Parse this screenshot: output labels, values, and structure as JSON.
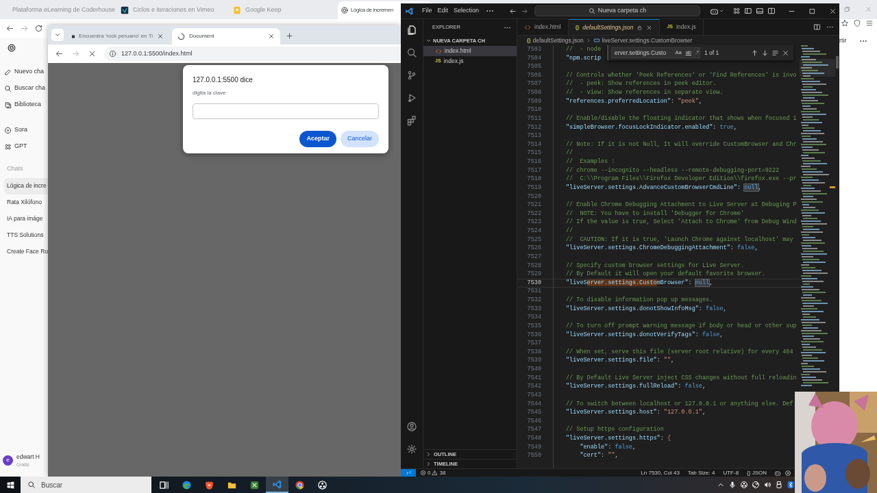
{
  "back_browser": {
    "tabs": [
      {
        "title": "Plataforma eLearning de Coderhouse",
        "kind": "coder",
        "selected": false
      },
      {
        "title": "Ciclos e iteraciones en Vimeo",
        "kind": "vimeo",
        "selected": false
      },
      {
        "title": "Google Keep",
        "kind": "keep",
        "selected": false
      },
      {
        "title": "Lógica de incremen",
        "kind": "openai",
        "selected": true
      }
    ],
    "sidebar": {
      "nav": [
        {
          "label": "Nuevo cha",
          "kind": "edit"
        },
        {
          "label": "Buscar cha",
          "kind": "search"
        },
        {
          "label": "Biblioteca",
          "kind": "library"
        },
        {
          "label": "Sora",
          "kind": "play"
        },
        {
          "label": "GPT",
          "kind": "grid"
        }
      ],
      "section": "Chats",
      "chats": [
        {
          "label": "Lógica de incre",
          "selected": true
        },
        {
          "label": "Rata Xilófono",
          "selected": false
        },
        {
          "label": "IA para imáge",
          "selected": false
        },
        {
          "label": "TTS Solutions",
          "selected": false
        },
        {
          "label": "Create Face Ru",
          "selected": false
        }
      ],
      "user": {
        "initial": "e",
        "name": "edwart H",
        "plan": "Gratis"
      }
    },
    "page_text": "rtir"
  },
  "front_browser": {
    "tabs": [
      {
        "title": "Encuentra 'rock peruano' en Ti",
        "kind": "tiktok",
        "selected": false
      },
      {
        "title": "Document",
        "kind": "loading",
        "selected": true
      }
    ],
    "address": "127.0.0.1:5500/index.html",
    "loading": true,
    "dialog": {
      "title": "127.0.0.1:5500 dice",
      "message": "digita la clave",
      "buttons": [
        {
          "label": "Aceptar",
          "kind": "primary"
        },
        {
          "label": "Cancelar",
          "kind": "secondary"
        }
      ]
    }
  },
  "vscode": {
    "menu": [
      "File",
      "Edit",
      "Selection"
    ],
    "search": "Nueva carpeta ch",
    "explorer": {
      "title": "EXPLORER",
      "folder": {
        "name": "NUEVA CARPETA CH",
        "expanded": true,
        "children": [
          {
            "name": "index.html",
            "kind": "html",
            "selected": true
          },
          {
            "name": "index.js",
            "kind": "js",
            "badge": "JS",
            "selected": false
          }
        ]
      },
      "sections": [
        {
          "label": "OUTLINE",
          "expanded": false
        },
        {
          "label": "TIMELINE",
          "expanded": false
        }
      ]
    },
    "tabs": [
      {
        "label": "index.html",
        "kind": "html",
        "selected": false,
        "preview": false,
        "readonly": false
      },
      {
        "label": "defaultSettings.json",
        "kind": "json",
        "badge": "{}",
        "selected": true,
        "preview": true,
        "readonly": true
      },
      {
        "label": "index.js",
        "kind": "js",
        "badge": "JS",
        "selected": false,
        "preview": false,
        "readonly": false
      }
    ],
    "breadcrumb": [
      {
        "label": "defaultSettings.json",
        "kind": "json",
        "badge": "{}"
      },
      {
        "label": "liveServer.settings.CustomBrowser",
        "kind": "property"
      }
    ],
    "find": {
      "query": "erver.settings.Custo",
      "options": [
        {
          "label": "Aa",
          "on": false
        },
        {
          "label": "ab",
          "on": false
        },
        {
          "label": ".*",
          "on": false
        }
      ],
      "result": "1 of 1"
    },
    "lines": [
      {
        "num": "7503",
        "current": false,
        "tokens": [
          {
            "t": "//  - node",
            "kind": "comment"
          }
        ]
      },
      {
        "num": "7504",
        "current": false,
        "tokens": [
          {
            "t": "\"npm.scrip",
            "kind": "key"
          }
        ]
      },
      {
        "num": "7505",
        "current": false
      },
      {
        "num": "7506",
        "current": false,
        "tokens": [
          {
            "t": "// Controls whether 'Peek References' or 'Find References' is invo",
            "kind": "comment"
          }
        ]
      },
      {
        "num": "7507",
        "current": false,
        "tokens": [
          {
            "t": "//  - peek: Show references in peek editor.",
            "kind": "comment"
          }
        ]
      },
      {
        "num": "7508",
        "current": false,
        "tokens": [
          {
            "t": "//  - view: Show references in separate view.",
            "kind": "comment"
          }
        ]
      },
      {
        "num": "7509",
        "current": false,
        "tokens": [
          {
            "t": "\"references.preferredLocation\"",
            "kind": "key"
          },
          {
            "t": ": ",
            "kind": "punct"
          },
          {
            "t": "\"peek\"",
            "kind": "string"
          },
          {
            "t": ",",
            "kind": "punct"
          }
        ]
      },
      {
        "num": "7510",
        "current": false
      },
      {
        "num": "7511",
        "current": false,
        "tokens": [
          {
            "t": "// Enable/disable the floating indicator that shows when focused i",
            "kind": "comment"
          }
        ]
      },
      {
        "num": "7512",
        "current": false,
        "tokens": [
          {
            "t": "\"simpleBrowser.focusLockIndicator.enabled\"",
            "kind": "key"
          },
          {
            "t": ": ",
            "kind": "punct"
          },
          {
            "t": "true",
            "kind": "literal"
          },
          {
            "t": ",",
            "kind": "punct"
          }
        ]
      },
      {
        "num": "7513",
        "current": false
      },
      {
        "num": "7514",
        "current": false,
        "tokens": [
          {
            "t": "// Note: If it is not Null, It will override CustomBrowser and Chr",
            "kind": "comment"
          }
        ]
      },
      {
        "num": "7515",
        "current": false,
        "tokens": [
          {
            "t": "//",
            "kind": "comment"
          }
        ]
      },
      {
        "num": "7516",
        "current": false,
        "tokens": [
          {
            "t": "//  Examples :",
            "kind": "comment"
          }
        ]
      },
      {
        "num": "7517",
        "current": false,
        "tokens": [
          {
            "t": "// chrome --incognito --headless --remote-debugging-port=9222",
            "kind": "comment"
          }
        ]
      },
      {
        "num": "7518",
        "current": false,
        "tokens": [
          {
            "t": "//  C:\\\\Program Files\\\\Firefox Developer Edition\\\\firefox.exe --pr",
            "kind": "comment"
          }
        ]
      },
      {
        "num": "7519",
        "current": false,
        "tokens": [
          {
            "t": "\"liveServer.settings.AdvanceCustomBrowserCmdLine\"",
            "kind": "key"
          },
          {
            "t": ": ",
            "kind": "punct"
          },
          {
            "t": "null",
            "kind": "literal-selected"
          },
          {
            "t": ",",
            "kind": "punct"
          }
        ]
      },
      {
        "num": "7520",
        "current": false
      },
      {
        "num": "7521",
        "current": false,
        "tokens": [
          {
            "t": "// Enable Chrome Debugging Attachment to Live Server at Debuging P",
            "kind": "comment"
          }
        ]
      },
      {
        "num": "7522",
        "current": false,
        "tokens": [
          {
            "t": "//  NOTE: You have to install 'Debugger for Chrome'",
            "kind": "comment"
          }
        ]
      },
      {
        "num": "7523",
        "current": false,
        "tokens": [
          {
            "t": "// If the value is true, Select 'Attach to Chrome' from Debug Wind",
            "kind": "comment"
          }
        ]
      },
      {
        "num": "7524",
        "current": false,
        "tokens": [
          {
            "t": "//",
            "kind": "comment"
          }
        ]
      },
      {
        "num": "7525",
        "current": false,
        "tokens": [
          {
            "t": "//  CAUTION: If it is true, 'Launch Chrome against localhost' may",
            "kind": "comment"
          }
        ]
      },
      {
        "num": "7526",
        "current": false,
        "tokens": [
          {
            "t": "\"liveServer.settings.ChromeDebuggingAttachment\"",
            "kind": "key"
          },
          {
            "t": ": ",
            "kind": "punct"
          },
          {
            "t": "false",
            "kind": "literal"
          },
          {
            "t": ",",
            "kind": "punct"
          }
        ]
      },
      {
        "num": "7527",
        "current": false
      },
      {
        "num": "7528",
        "current": false,
        "tokens": [
          {
            "t": "// Specify custom browser settings for Live Server.",
            "kind": "comment"
          }
        ]
      },
      {
        "num": "7529",
        "current": false,
        "tokens": [
          {
            "t": "// By Default it will open your default favorite browser.",
            "kind": "comment"
          }
        ]
      },
      {
        "num": "7530",
        "current": true,
        "tokens": [
          {
            "t": "\"liveS",
            "kind": "key"
          },
          {
            "t": "erver.settings.Custo",
            "kind": "key-match"
          },
          {
            "t": "mBrowser\"",
            "kind": "key"
          },
          {
            "t": ": ",
            "kind": "punct"
          },
          {
            "t": "null",
            "kind": "literal-selected"
          },
          {
            "t": ",",
            "kind": "punct"
          }
        ]
      },
      {
        "num": "7531",
        "current": false
      },
      {
        "num": "7532",
        "current": false,
        "tokens": [
          {
            "t": "// To disable information pop up messages.",
            "kind": "comment"
          }
        ]
      },
      {
        "num": "7533",
        "current": false,
        "tokens": [
          {
            "t": "\"liveServer.settings.donotShowInfoMsg\"",
            "kind": "key"
          },
          {
            "t": ": ",
            "kind": "punct"
          },
          {
            "t": "false",
            "kind": "literal"
          },
          {
            "t": ",",
            "kind": "punct"
          }
        ]
      },
      {
        "num": "7534",
        "current": false
      },
      {
        "num": "7535",
        "current": false,
        "tokens": [
          {
            "t": "// To turn off prompt warning message if body or head or other sup",
            "kind": "comment"
          }
        ]
      },
      {
        "num": "7536",
        "current": false,
        "tokens": [
          {
            "t": "\"liveServer.settings.donotVerifyTags\"",
            "kind": "key"
          },
          {
            "t": ": ",
            "kind": "punct"
          },
          {
            "t": "false",
            "kind": "literal"
          },
          {
            "t": ",",
            "kind": "punct"
          }
        ]
      },
      {
        "num": "7537",
        "current": false
      },
      {
        "num": "7538",
        "current": false,
        "tokens": [
          {
            "t": "// When set, serve this file (server root relative) for every 404",
            "kind": "comment"
          }
        ]
      },
      {
        "num": "7539",
        "current": false,
        "tokens": [
          {
            "t": "\"liveServer.settings.file\"",
            "kind": "key"
          },
          {
            "t": ": ",
            "kind": "punct"
          },
          {
            "t": "\"\"",
            "kind": "string"
          },
          {
            "t": ",",
            "kind": "punct"
          }
        ]
      },
      {
        "num": "7540",
        "current": false
      },
      {
        "num": "7541",
        "current": false,
        "tokens": [
          {
            "t": "// By Default Live Server inject CSS changes without full reloadin",
            "kind": "comment"
          }
        ]
      },
      {
        "num": "7542",
        "current": false,
        "tokens": [
          {
            "t": "\"liveServer.settings.fullReload\"",
            "kind": "key"
          },
          {
            "t": ": ",
            "kind": "punct"
          },
          {
            "t": "false",
            "kind": "literal"
          },
          {
            "t": ",",
            "kind": "punct"
          }
        ]
      },
      {
        "num": "7543",
        "current": false
      },
      {
        "num": "7544",
        "current": false,
        "tokens": [
          {
            "t": "// To switch between localhost or 127.0.0.1 or anything else. Def",
            "kind": "comment"
          }
        ]
      },
      {
        "num": "7545",
        "current": false,
        "tokens": [
          {
            "t": "\"liveServer.settings.host\"",
            "kind": "key"
          },
          {
            "t": ": ",
            "kind": "punct"
          },
          {
            "t": "\"127.0.0.1\"",
            "kind": "string"
          },
          {
            "t": ",",
            "kind": "punct"
          }
        ]
      },
      {
        "num": "7546",
        "current": false
      },
      {
        "num": "7547",
        "current": false,
        "tokens": [
          {
            "t": "// Setup https configuration",
            "kind": "comment"
          }
        ]
      },
      {
        "num": "7548",
        "current": false,
        "tokens": [
          {
            "t": "\"liveServer.settings.https\"",
            "kind": "key"
          },
          {
            "t": ": ",
            "kind": "punct"
          },
          {
            "t": "{",
            "kind": "string"
          }
        ]
      },
      {
        "num": "7549",
        "current": false,
        "tokens": [
          {
            "t": "    \"enable\"",
            "kind": "key"
          },
          {
            "t": ": ",
            "kind": "punct"
          },
          {
            "t": "false",
            "kind": "literal"
          },
          {
            "t": ",",
            "kind": "punct"
          }
        ]
      },
      {
        "num": "7550",
        "current": false,
        "tokens": [
          {
            "t": "    \"cert\"",
            "kind": "key"
          },
          {
            "t": ": ",
            "kind": "punct"
          },
          {
            "t": "\"\"",
            "kind": "string"
          },
          {
            "t": ",",
            "kind": "punct"
          }
        ]
      }
    ],
    "status": {
      "errors": "0",
      "warnings": "38",
      "items": [
        "Ln 7530, Col 43",
        "Tab Size: 4",
        "UTF-8",
        "{} JSON"
      ]
    }
  },
  "taskbar": {
    "search": "Buscar",
    "apps": [
      {
        "kind": "taskview",
        "selected": false
      },
      {
        "kind": "edge",
        "selected": false
      },
      {
        "kind": "brave",
        "selected": false
      },
      {
        "kind": "files",
        "selected": false
      },
      {
        "kind": "xapp",
        "selected": false
      },
      {
        "kind": "vscode",
        "selected": true
      },
      {
        "kind": "chrome",
        "selected": false
      },
      {
        "kind": "obs",
        "selected": false
      }
    ]
  }
}
